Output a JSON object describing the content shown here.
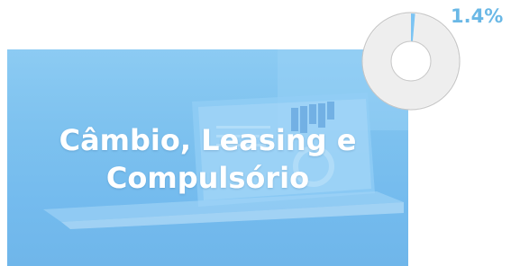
{
  "card": {
    "title_line1": "Câmbio, Leasing e",
    "title_line2": "Compulsório"
  },
  "indicator": {
    "percent_label": "1.4%",
    "value_fraction": 0.014,
    "fill_color": "#7cc4f3",
    "track_color": "#eeeeee",
    "outline_color": "#c8c8c8"
  }
}
